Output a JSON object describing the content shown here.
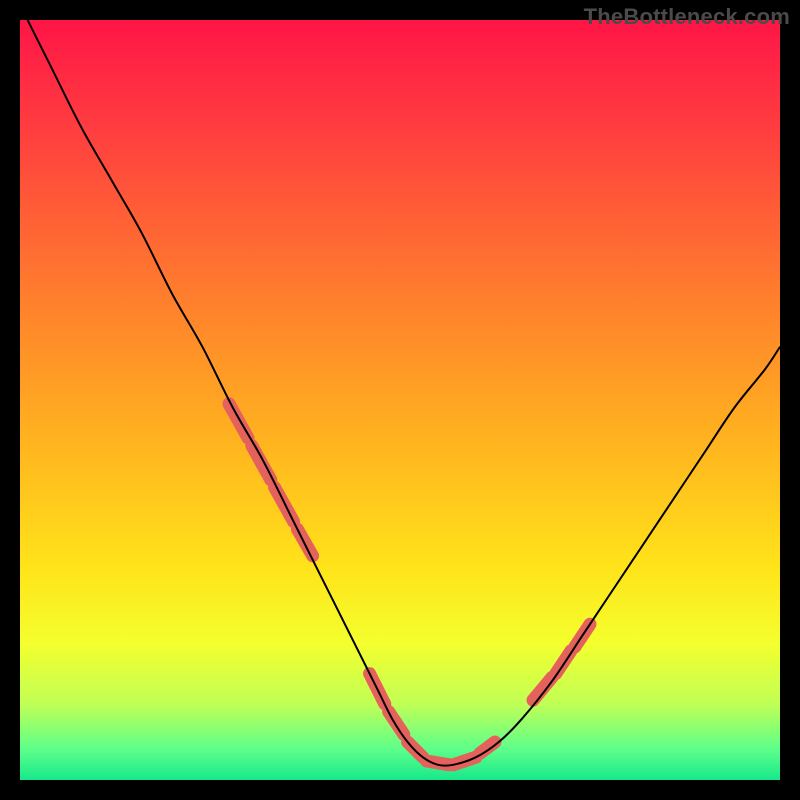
{
  "watermark": "TheBottleneck.com",
  "colors": {
    "background": "#000000",
    "curve": "#000000",
    "marker_fill": "#e4615c",
    "gradient_stops": [
      {
        "offset": 0.0,
        "color": "#ff1547"
      },
      {
        "offset": 0.15,
        "color": "#ff3f3f"
      },
      {
        "offset": 0.35,
        "color": "#ff7a2e"
      },
      {
        "offset": 0.55,
        "color": "#ffb21f"
      },
      {
        "offset": 0.72,
        "color": "#ffe31a"
      },
      {
        "offset": 0.82,
        "color": "#f4ff2e"
      },
      {
        "offset": 0.9,
        "color": "#c0ff55"
      },
      {
        "offset": 0.96,
        "color": "#5cff8a"
      },
      {
        "offset": 1.0,
        "color": "#17e88b"
      }
    ]
  },
  "chart_data": {
    "type": "line",
    "title": "",
    "xlabel": "",
    "ylabel": "",
    "xlim": [
      0,
      100
    ],
    "ylim": [
      0,
      100
    ],
    "grid": false,
    "legend": false,
    "series": [
      {
        "name": "bottleneck-curve",
        "x": [
          1,
          4,
          8,
          12,
          16,
          20,
          24,
          28,
          32,
          36,
          40,
          44,
          47,
          49,
          51,
          53,
          55,
          57,
          60,
          63,
          66,
          70,
          74,
          78,
          82,
          86,
          90,
          94,
          98,
          100
        ],
        "y": [
          100,
          94,
          86,
          79,
          72,
          64,
          57,
          49,
          42,
          34,
          26,
          18,
          12,
          8,
          5,
          3,
          2,
          2,
          3,
          5,
          8,
          13,
          19,
          25,
          31,
          37,
          43,
          49,
          54,
          57
        ]
      }
    ],
    "markers": {
      "name": "highlight-segments",
      "style": "rounded-dash",
      "segments": [
        {
          "x": [
            27.5,
            30.0
          ],
          "y": [
            49.5,
            45.0
          ]
        },
        {
          "x": [
            30.5,
            33.0
          ],
          "y": [
            44.0,
            39.5
          ]
        },
        {
          "x": [
            33.5,
            36.0
          ],
          "y": [
            38.5,
            34.0
          ]
        },
        {
          "x": [
            36.5,
            38.5
          ],
          "y": [
            33.0,
            29.5
          ]
        },
        {
          "x": [
            46.0,
            48.0
          ],
          "y": [
            14.0,
            10.0
          ]
        },
        {
          "x": [
            48.5,
            50.5
          ],
          "y": [
            9.0,
            6.0
          ]
        },
        {
          "x": [
            51.0,
            53.0
          ],
          "y": [
            5.0,
            3.0
          ]
        },
        {
          "x": [
            53.5,
            56.5
          ],
          "y": [
            2.5,
            2.0
          ]
        },
        {
          "x": [
            57.0,
            60.0
          ],
          "y": [
            2.0,
            3.0
          ]
        },
        {
          "x": [
            60.5,
            62.5
          ],
          "y": [
            3.5,
            5.0
          ]
        },
        {
          "x": [
            67.5,
            70.0
          ],
          "y": [
            10.5,
            13.5
          ]
        },
        {
          "x": [
            70.5,
            72.5
          ],
          "y": [
            14.0,
            17.0
          ]
        },
        {
          "x": [
            73.0,
            75.0
          ],
          "y": [
            17.5,
            20.5
          ]
        }
      ]
    }
  }
}
